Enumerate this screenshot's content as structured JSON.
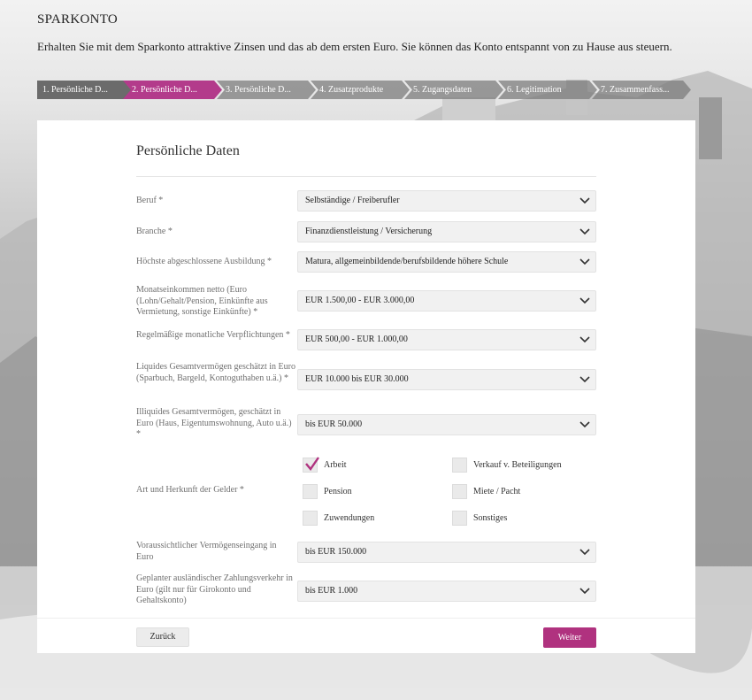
{
  "header": {
    "brand": "SPARKONTO",
    "subtitle": "Erhalten Sie mit dem Sparkonto attraktive Zinsen und das ab dem ersten Euro. Sie können das Konto entspannt von zu Hause aus steuern."
  },
  "steps": [
    {
      "label": "1. Persönliche D...",
      "state": "done"
    },
    {
      "label": "2. Persönliche D...",
      "state": "active"
    },
    {
      "label": "3. Persönliche D...",
      "state": "todo"
    },
    {
      "label": "4. Zusatzprodukte",
      "state": "todo"
    },
    {
      "label": "5. Zugangsdaten",
      "state": "todo"
    },
    {
      "label": "6. Legitimation",
      "state": "todo"
    },
    {
      "label": "7. Zusammenfass...",
      "state": "todo"
    }
  ],
  "form": {
    "title": "Persönliche Daten",
    "fields": [
      {
        "label": "Beruf *",
        "value": "Selbständige / Freiberufler"
      },
      {
        "label": "Branche *",
        "value": "Finanzdienstleistung / Versicherung"
      },
      {
        "label": "Höchste abgeschlossene Ausbildung *",
        "value": "Matura, allgemeinbildende/berufsbildende höhere Schule"
      },
      {
        "label": "Monatseinkommen netto (Euro (Lohn/Gehalt/Pension, Einkünfte aus Vermietung, sonstige Einkünfte) *",
        "value": "EUR 1.500,00 - EUR 3.000,00"
      },
      {
        "label": "Regelmäßige monatliche Verpflichtungen *",
        "value": "EUR 500,00 - EUR 1.000,00"
      },
      {
        "label": "Liquides Gesamtvermögen geschätzt in Euro (Sparbuch, Bargeld, Kontoguthaben u.ä.) *",
        "value": "EUR 10.000 bis EUR 30.000"
      },
      {
        "label": "Illiquides Gesamtvermögen, geschätzt in Euro (Haus, Eigentumswohnung, Auto u.ä.) *",
        "value": "bis EUR 50.000"
      }
    ],
    "funds": {
      "label": "Art und Herkunft der Gelder *",
      "options": [
        {
          "label": "Arbeit",
          "checked": true
        },
        {
          "label": "Verkauf v. Beteiligungen",
          "checked": false
        },
        {
          "label": "Pension",
          "checked": false
        },
        {
          "label": "Miete / Pacht",
          "checked": false
        },
        {
          "label": "Zuwendungen",
          "checked": false
        },
        {
          "label": "Sonstiges",
          "checked": false
        }
      ]
    },
    "fields2": [
      {
        "label": "Voraussichtlicher Vermögenseingang in Euro",
        "value": "bis EUR 150.000"
      },
      {
        "label": "Geplanter ausländischer Zahlungsverkehr in Euro (gilt nur für Girokonto und Gehaltskonto)",
        "value": "bis EUR 1.000"
      }
    ]
  },
  "buttons": {
    "back": "Zurück",
    "next": "Weiter"
  },
  "colors": {
    "accent": "#b0327f",
    "step_done": "#6b6b6b"
  }
}
